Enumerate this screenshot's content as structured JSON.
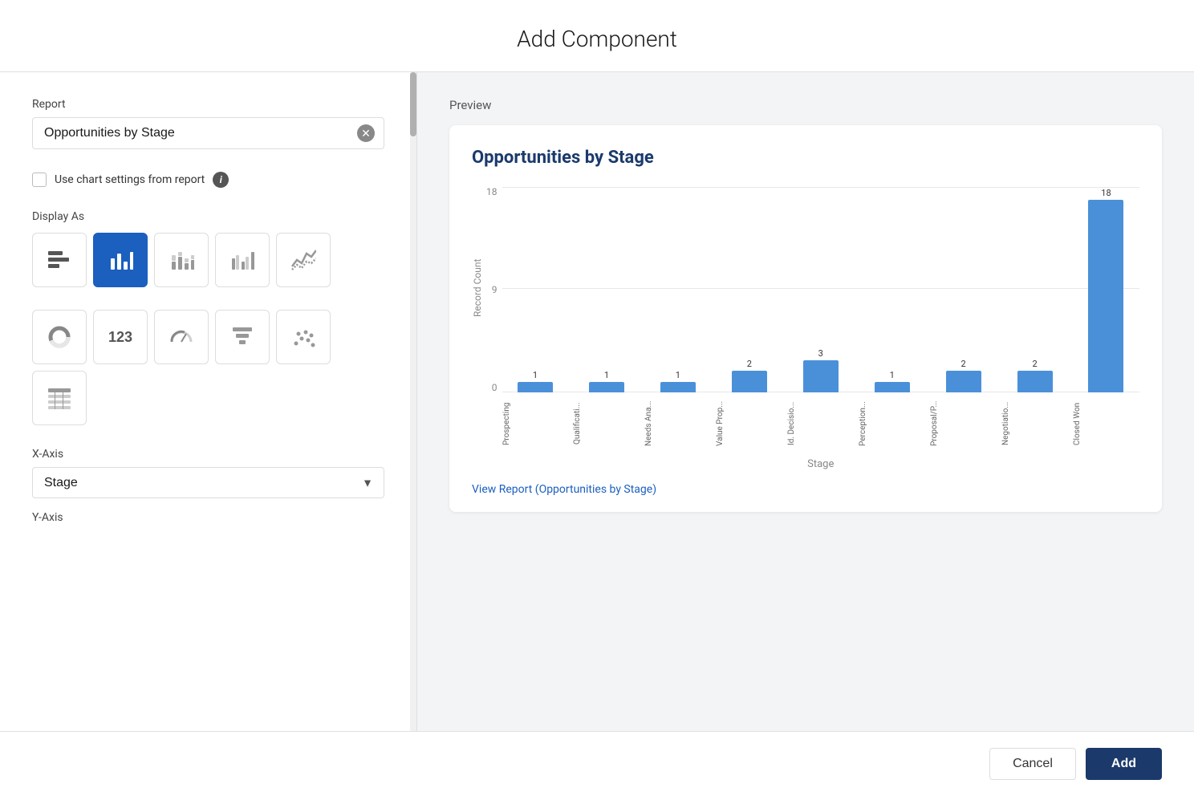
{
  "modal": {
    "title": "Add Component"
  },
  "left": {
    "report_label": "Report",
    "report_value": "Opportunities by Stage",
    "checkbox_label": "Use chart settings from report",
    "display_as_label": "Display As",
    "chart_types": [
      {
        "id": "horizontal-bar",
        "icon": "horizontal-bar",
        "active": false
      },
      {
        "id": "vertical-bar",
        "icon": "vertical-bar",
        "active": true
      },
      {
        "id": "stacked-bar",
        "icon": "stacked-bar",
        "active": false
      },
      {
        "id": "grouped-bar",
        "icon": "grouped-bar",
        "active": false
      },
      {
        "id": "line",
        "icon": "line",
        "active": false
      },
      {
        "id": "donut",
        "icon": "donut",
        "active": false
      },
      {
        "id": "number",
        "icon": "number",
        "active": false
      },
      {
        "id": "gauge",
        "icon": "gauge",
        "active": false
      },
      {
        "id": "funnel",
        "icon": "funnel",
        "active": false
      },
      {
        "id": "scatter",
        "icon": "scatter",
        "active": false
      },
      {
        "id": "table",
        "icon": "table",
        "active": false
      }
    ],
    "xaxis_label": "X-Axis",
    "xaxis_value": "Stage",
    "yaxis_label": "Y-Axis"
  },
  "preview": {
    "label": "Preview",
    "chart_title": "Opportunities by Stage",
    "y_axis_label": "Record Count",
    "x_axis_label": "Stage",
    "y_ticks": [
      "18",
      "9",
      "0"
    ],
    "bars": [
      {
        "label": "Prospecting",
        "value": 1,
        "height_pct": 5
      },
      {
        "label": "Qualificati...",
        "value": 1,
        "height_pct": 5
      },
      {
        "label": "Needs Ana...",
        "value": 1,
        "height_pct": 5
      },
      {
        "label": "Value Prop...",
        "value": 2,
        "height_pct": 10
      },
      {
        "label": "Id. Decisio...",
        "value": 3,
        "height_pct": 16
      },
      {
        "label": "Perception...",
        "value": 1,
        "height_pct": 5
      },
      {
        "label": "Proposal/P...",
        "value": 2,
        "height_pct": 10
      },
      {
        "label": "Negotiatio...",
        "value": 2,
        "height_pct": 10
      },
      {
        "label": "Closed Won",
        "value": 18,
        "height_pct": 100
      }
    ],
    "view_report_link": "View Report (Opportunities by Stage)"
  },
  "footer": {
    "cancel_label": "Cancel",
    "add_label": "Add"
  }
}
